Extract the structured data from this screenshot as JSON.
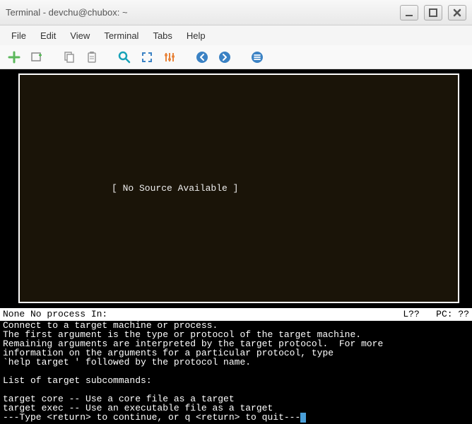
{
  "window": {
    "title": "Terminal - devchu@chubox: ~"
  },
  "menu": {
    "items": [
      "File",
      "Edit",
      "View",
      "Terminal",
      "Tabs",
      "Help"
    ]
  },
  "toolbar_icons": [
    "new-tab-icon",
    "new-window-icon",
    "copy-icon",
    "paste-icon",
    "search-icon",
    "fullscreen-icon",
    "preferences-icon",
    "go-previous-icon",
    "go-next-icon",
    "menu-icon"
  ],
  "colors": {
    "accent_green": "#5cb85c",
    "accent_cyan": "#17a2b8",
    "accent_blue": "#3b82c4",
    "accent_orange": "#e8833a",
    "icon_gray": "#888"
  },
  "source_pane": {
    "message": "[ No Source Available ]"
  },
  "status": {
    "left": "None No process In:",
    "right": "L??   PC: ??"
  },
  "gdb": {
    "lines": [
      "Connect to a target machine or process.",
      "The first argument is the type or protocol of the target machine.",
      "Remaining arguments are interpreted by the target protocol.  For more",
      "information on the arguments for a particular protocol, type",
      "`help target ' followed by the protocol name.",
      "",
      "List of target subcommands:",
      "",
      "target core -- Use a core file as a target",
      "target exec -- Use an executable file as a target",
      "---Type <return> to continue, or q <return> to quit---"
    ]
  }
}
